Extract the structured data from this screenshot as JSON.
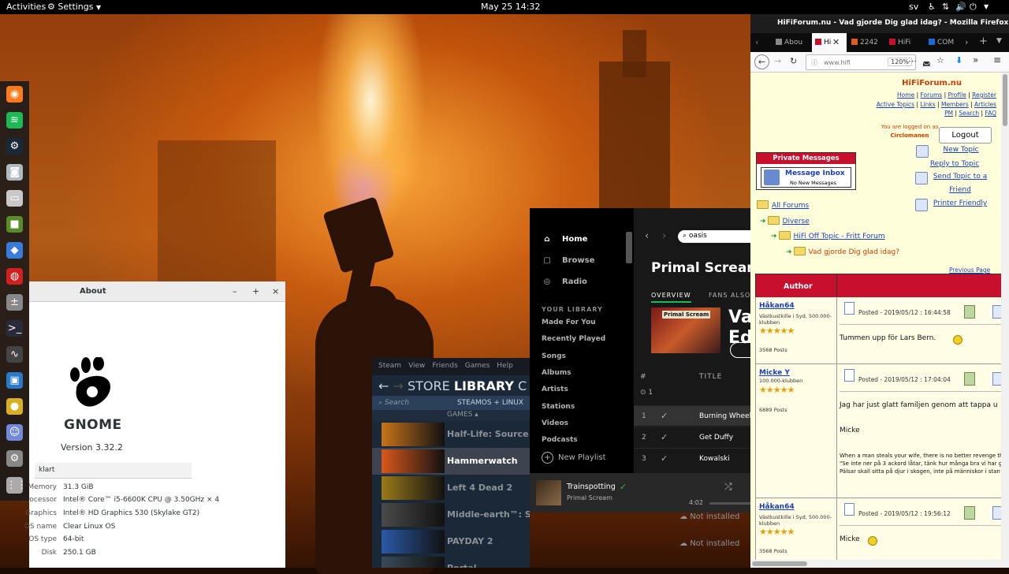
{
  "topbar": {
    "activities": "Activities",
    "app_menu": "Settings",
    "clock": "May 25  14:32",
    "lang": "sv"
  },
  "dock": {
    "items": [
      {
        "label": "Firefox",
        "icon": "firefox-icon",
        "color": "#ff7b1a"
      },
      {
        "label": "Spotify",
        "icon": "spotify-icon",
        "color": "#1db954"
      },
      {
        "label": "Steam",
        "icon": "steam-icon",
        "color": "#1b2838"
      },
      {
        "label": "Screenshot",
        "icon": "camera-icon",
        "color": "#b0b8c0"
      },
      {
        "label": "Files",
        "icon": "folder-icon",
        "color": "#c8c8c8"
      },
      {
        "label": "Minecraft",
        "icon": "minecraft-icon",
        "color": "#5b8c2a"
      },
      {
        "label": "App",
        "icon": "diamond-icon",
        "color": "#3a7ad8"
      },
      {
        "label": "App",
        "icon": "ubuntu-icon",
        "color": "#d02020"
      },
      {
        "label": "Calculator",
        "icon": "calculator-icon",
        "color": "#888888"
      },
      {
        "label": "Terminal",
        "icon": "terminal-icon",
        "color": "#2a2a3a"
      },
      {
        "label": "System Monitor",
        "icon": "monitor-icon",
        "color": "#444444"
      },
      {
        "label": "Remote",
        "icon": "screen-icon",
        "color": "#2a7ac8"
      },
      {
        "label": "Game",
        "icon": "ball-icon",
        "color": "#d8b020"
      },
      {
        "label": "Discord",
        "icon": "discord-icon",
        "color": "#7289da"
      },
      {
        "label": "Settings",
        "icon": "gear-icon",
        "color": "#888888"
      },
      {
        "label": "Show Applications",
        "icon": "grid-icon",
        "color": "#aaaaaa"
      }
    ]
  },
  "about": {
    "title": "About",
    "minimize": "–",
    "maximize": "+",
    "close": "×",
    "gnome": "GNOME",
    "version": "Version 3.32.2",
    "device_name": "klart",
    "specs": [
      {
        "key": "Memory",
        "value": "31.3 GiB"
      },
      {
        "key": "Processor",
        "value": "Intel® Core™ i5-6600K CPU @ 3.50GHz × 4"
      },
      {
        "key": "Graphics",
        "value": "Intel® HD Graphics 530 (Skylake GT2)"
      },
      {
        "key": "OS name",
        "value": "Clear Linux OS"
      },
      {
        "key": "OS type",
        "value": "64-bit"
      },
      {
        "key": "Disk",
        "value": "250.1 GB"
      }
    ]
  },
  "steam": {
    "menu": [
      "Steam",
      "View",
      "Friends",
      "Games",
      "Help"
    ],
    "nav": {
      "store": "STORE",
      "library": "LIBRARY",
      "cut": "C"
    },
    "search_placeholder": "Search",
    "filter": "STEAMOS + LINUX",
    "games_header": "GAMES ▴",
    "games": [
      {
        "name": "Half-Life: Source",
        "color": "#c8741a"
      },
      {
        "name": "Hammerwatch",
        "color": "#d8581a"
      },
      {
        "name": "Left 4 Dead 2",
        "color": "#9a7a1a"
      },
      {
        "name": "Middle-earth™: Shadow of Mordor™",
        "color": "#4a4a4a"
      },
      {
        "name": "PAYDAY 2",
        "color": "#2a5aa8"
      },
      {
        "name": "Portal",
        "color": "#3a4a5a"
      }
    ],
    "not_installed": "Not installed"
  },
  "spotify": {
    "nav": [
      {
        "label": "Home",
        "icon": "home-icon"
      },
      {
        "label": "Browse",
        "icon": "browse-icon"
      },
      {
        "label": "Radio",
        "icon": "radio-icon"
      }
    ],
    "library_title": "YOUR LIBRARY",
    "library": [
      "Made For You",
      "Recently Played",
      "Songs",
      "Albums",
      "Artists",
      "Stations",
      "Videos",
      "Podcasts"
    ],
    "new_playlist": "New Playlist",
    "search_value": "oasis",
    "artist": "Primal Scream",
    "tabs": [
      "OVERVIEW",
      "FANS ALSO"
    ],
    "album_big": "Va Ed",
    "col_num": "#",
    "col_title": "TITLE",
    "disc": "1",
    "tracks": [
      {
        "n": "1",
        "title": "Burning Wheel"
      },
      {
        "n": "2",
        "title": "Get Duffy"
      },
      {
        "n": "3",
        "title": "Kowalski"
      }
    ],
    "now_playing": {
      "title": "Trainspotting",
      "artist": "Primal Scream",
      "time": "4:02",
      "progress": 0.0
    }
  },
  "firefox": {
    "window_title": "HiFiForum.nu - Vad gjorde Dig glad idag? - Mozilla Firefox",
    "tabs": [
      {
        "label": "Abou",
        "active": false
      },
      {
        "label": "Hi",
        "active": true
      },
      {
        "label": "2242",
        "active": false
      },
      {
        "label": "HiFi",
        "active": false
      },
      {
        "label": "COM",
        "active": false
      }
    ],
    "url": "www.hifi",
    "zoom": "120%",
    "site_title": "HiFiForum.nu",
    "top_links": [
      [
        "Home",
        "Forums",
        "Profile",
        "Register"
      ],
      [
        "Active Topics",
        "Links",
        "Members",
        "Articles"
      ],
      [
        "PM",
        "Search",
        "FAQ"
      ]
    ],
    "logged_on": "You are logged on as",
    "username": "Circlomanen",
    "logout": "Logout",
    "pm_header": "Private Messages",
    "inbox_title": "Message Inbox",
    "inbox_sub": "No New Messages",
    "breadcrumbs": [
      "All Forums",
      "Diverse",
      "HiFi Off Topic - Fritt Forum",
      "Vad gjorde Dig glad idag?"
    ],
    "actions": [
      "New Topic",
      "Reply to Topic",
      "Send Topic to a Friend",
      "Printer Friendly"
    ],
    "previous_page": "Previous Page",
    "author_header": "Author",
    "posts": [
      {
        "user": "Håkan64",
        "sub": "Västkustkille i Syd, 500.000-klubben",
        "rating": 5,
        "count": "3568 Posts",
        "posted": "Posted - 2019/05/12 :  16:44:58",
        "body": "Tummen upp för Lars Bern.",
        "extra": []
      },
      {
        "user": "Micke Y",
        "sub": "100.000-klubben",
        "rating": 5,
        "count": "6889 Posts",
        "posted": "Posted - 2019/05/12 :  17:04:04",
        "body": "Jag har just glatt familjen genom att tappa u",
        "extra": [
          "Micke",
          "When a man steals your wife, there is no better revenge th",
          "\"Se inte ner på 3 ackord låtar, tänk hur många bra vi har g",
          "Pälsar skall sitta på djur i skogen, inte på människor i stan"
        ]
      },
      {
        "user": "Håkan64",
        "sub": "Västkustkille i Syd, 500.000-klubben",
        "rating": 5,
        "count": "3568 Posts",
        "posted": "Posted - 2019/05/12 :  19:56:12",
        "body": "Micke",
        "extra": []
      }
    ]
  }
}
